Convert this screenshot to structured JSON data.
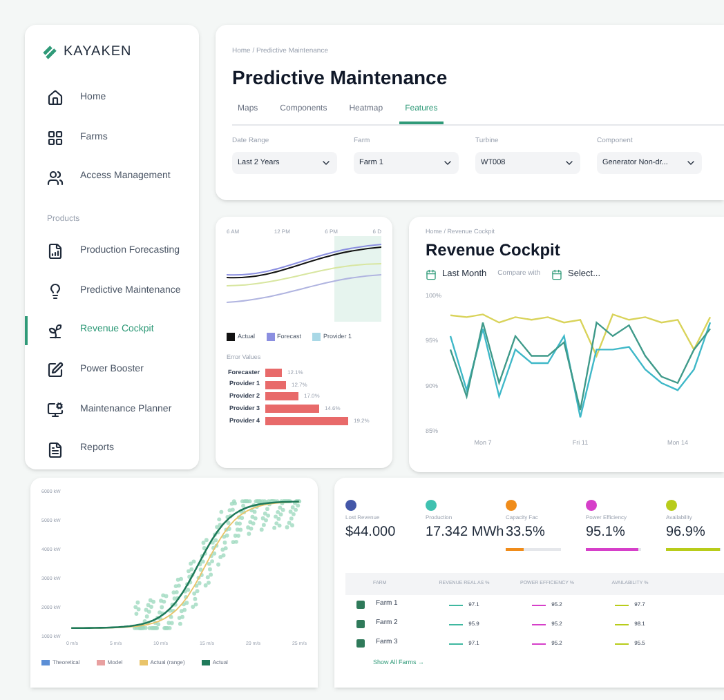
{
  "brand": {
    "name": "KAYAKEN"
  },
  "sidebar": {
    "items": [
      {
        "label": "Home",
        "selected": false
      },
      {
        "label": "Farms",
        "selected": false
      },
      {
        "label": "Access Management",
        "selected": false
      }
    ],
    "section_label": "Products",
    "products": [
      {
        "label": "Production Forecasting",
        "selected": false
      },
      {
        "label": "Predictive Maintenance",
        "selected": false
      },
      {
        "label": "Revenue Cockpit",
        "selected": true
      },
      {
        "label": "Power Booster",
        "selected": false
      },
      {
        "label": "Maintenance Planner",
        "selected": false
      },
      {
        "label": "Reports",
        "selected": false
      }
    ]
  },
  "header": {
    "breadcrumb": "Home / Predictive Maintenance",
    "title": "Predictive Maintenance",
    "tabs": [
      {
        "label": "Maps",
        "selected": false
      },
      {
        "label": "Components",
        "selected": false
      },
      {
        "label": "Heatmap",
        "selected": false
      },
      {
        "label": "Features",
        "selected": true
      }
    ],
    "filters": [
      {
        "label": "Date Range",
        "value": "Last 2 Years"
      },
      {
        "label": "Farm",
        "value": "Farm 1"
      },
      {
        "label": "Turbine",
        "value": "WT008"
      },
      {
        "label": "Component",
        "value": "Generator Non-dr..."
      }
    ]
  },
  "forecast_card": {
    "x_labels": [
      "6 AM",
      "12 PM",
      "6 PM",
      "6 D"
    ],
    "legend": [
      {
        "label": "Actual",
        "color": "#111111"
      },
      {
        "label": "Forecast",
        "color": "#8b8fe0"
      },
      {
        "label": "Provider 1",
        "color": "#a9d8e6"
      }
    ],
    "errors_title": "Error Values",
    "errors": [
      {
        "label": "Forecaster",
        "value": "12.1%"
      },
      {
        "label": "Provider 1",
        "value": "12.7%"
      },
      {
        "label": "Provider 2",
        "value": "17.0%"
      },
      {
        "label": "Provider 3",
        "value": "14.6%"
      },
      {
        "label": "Provider 4",
        "value": "19.2%"
      }
    ]
  },
  "revenue": {
    "breadcrumb": "Home / Revenue Cockpit",
    "title": "Revenue Cockpit",
    "period": "Last Month",
    "compare_label": "Compare with",
    "compare_value": "Select...",
    "chart_data": {
      "type": "line",
      "ylim": [
        85,
        100
      ],
      "yticks": [
        {
          "value": 100,
          "label": "100%"
        },
        {
          "value": 95,
          "label": "95%"
        },
        {
          "value": 90,
          "label": "90%"
        },
        {
          "value": 85,
          "label": "85%"
        }
      ],
      "categories": [
        null,
        null,
        "Mon 7",
        null,
        null,
        null,
        null,
        null,
        "Fri 11",
        null,
        null,
        null,
        null,
        null,
        "Mon 14",
        null,
        null
      ],
      "series": [
        {
          "color": "#d9d35a",
          "values": [
            97.8,
            97.6,
            97.9,
            97,
            97.6,
            97.3,
            97.6,
            97,
            97.3,
            93.3,
            97.9,
            97.3,
            97.6,
            97,
            97.3,
            94,
            97.6
          ]
        },
        {
          "color": "#3fb8c8",
          "values": [
            95.5,
            89.5,
            96.3,
            88.8,
            94,
            92.5,
            92.5,
            95.5,
            86.5,
            94,
            94,
            94.3,
            91.8,
            90.3,
            89.5,
            91.8,
            97
          ]
        },
        {
          "color": "#3f9a8a",
          "values": [
            94,
            88.8,
            97,
            90.3,
            95.5,
            93.3,
            93.3,
            94.8,
            87.3,
            97,
            95.5,
            96.7,
            93.3,
            91,
            90.3,
            94,
            96.3
          ]
        }
      ]
    }
  },
  "power_curve": {
    "y_labels": [
      "6000 kW",
      "5000 kW",
      "4000 kW",
      "3000 kW",
      "2000 kW",
      "1000 kW"
    ],
    "x_labels": [
      "0 m/s",
      "5 m/s",
      "10 m/s",
      "15 m/s",
      "20 m/s",
      "25 m/s"
    ],
    "legend": [
      {
        "label": "Theoretical",
        "color": "#5c8fd6"
      },
      {
        "label": "Model",
        "color": "#e8a0a0"
      },
      {
        "label": "Actual (range)",
        "color": "#e9c46a"
      },
      {
        "label": "Actual",
        "color": "#1f7a5a"
      }
    ]
  },
  "kpis": [
    {
      "label": "Lost Revenue",
      "value": "$44.000",
      "color": "#4457a8"
    },
    {
      "label": "Production",
      "value": "17.342 MWh",
      "color": "#3fc1b0"
    },
    {
      "label": "Capacity Fac",
      "value": "33.5%",
      "color": "#f08c1a",
      "level": 0.335
    },
    {
      "label": "Power Efficiency",
      "value": "95.1%",
      "color": "#d63fc9",
      "level": 0.951
    },
    {
      "label": "Availability",
      "value": "96.9%",
      "color": "#b8cc1a",
      "level": 0.969
    }
  ],
  "table": {
    "columns": [
      "FARM",
      "REVENUE REAL AS %",
      "POWER EFFICIENCY %",
      "AVAILABILITY %"
    ],
    "rows": [
      {
        "checked": true,
        "cells": [
          "Farm 1",
          "97.1",
          "95.2",
          "97.7"
        ]
      },
      {
        "checked": true,
        "cells": [
          "Farm 2",
          "95.9",
          "95.2",
          "98.1"
        ]
      },
      {
        "checked": true,
        "cells": [
          "Farm 3",
          "97.1",
          "95.2",
          "95.5"
        ]
      }
    ],
    "footer_link": "Show All Farms →"
  }
}
